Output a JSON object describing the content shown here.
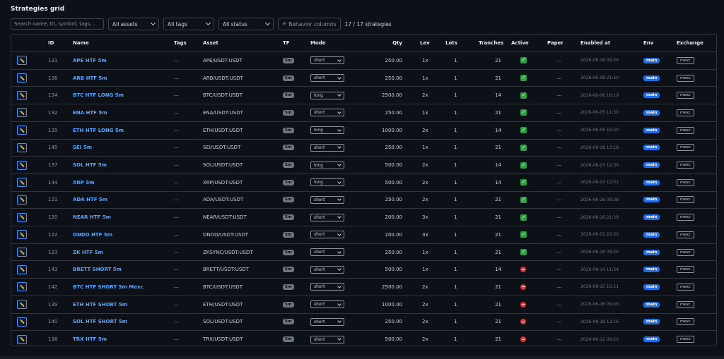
{
  "title": "Strategies grid",
  "toolbar": {
    "search_placeholder": "Search name, ID, symbol, tags…",
    "assets_filter": "All assets",
    "tags_filter": "All tags",
    "status_filter": "All status",
    "behavior_columns_label": "Behavior columns",
    "count_text": "17 / 17 strategies"
  },
  "columns": {
    "id": "ID",
    "name": "Name",
    "tags": "Tags",
    "asset": "Asset",
    "tf": "TF",
    "mode": "Mode",
    "qty": "Qty",
    "lev": "Lev",
    "lots": "Lots",
    "tranches": "Tranches",
    "active": "Active",
    "paper": "Paper",
    "enabled_at": "Enabled at",
    "env": "Env",
    "exchange": "Exchange"
  },
  "rows": [
    {
      "id": "131",
      "name": "APE HTF 5m",
      "tags": "—",
      "asset": "APE/USDT:USDT",
      "tf": "5m",
      "mode": "short",
      "qty": "250.00",
      "lev": "1x",
      "lots": "1",
      "tranches": "21",
      "active": true,
      "paper": "—",
      "enabled_at": "2026-08-16 09:26",
      "env": "main",
      "exchange": "mexc"
    },
    {
      "id": "136",
      "name": "ARB HTF 5m",
      "tags": "—",
      "asset": "ARB/USDT:USDT",
      "tf": "5m",
      "mode": "short",
      "qty": "250.00",
      "lev": "1x",
      "lots": "1",
      "tranches": "21",
      "active": true,
      "paper": "—",
      "enabled_at": "2026-06-08 21:50",
      "env": "main",
      "exchange": "mexc"
    },
    {
      "id": "134",
      "name": "BTC HTF LONG 5m",
      "tags": "—",
      "asset": "BTC/USDT:USDT",
      "tf": "5m",
      "mode": "long",
      "qty": "2500.00",
      "lev": "2x",
      "lots": "1",
      "tranches": "14",
      "active": true,
      "paper": "—",
      "enabled_at": "2026-06-06 16:19",
      "env": "main",
      "exchange": "mexc"
    },
    {
      "id": "132",
      "name": "ENA HTF 5m",
      "tags": "—",
      "asset": "ENA/USDT:USDT",
      "tf": "5m",
      "mode": "short",
      "qty": "250.00",
      "lev": "1x",
      "lots": "1",
      "tranches": "21",
      "active": true,
      "paper": "—",
      "enabled_at": "2026-06-05 11:30",
      "env": "main",
      "exchange": "mexc"
    },
    {
      "id": "135",
      "name": "ETH HTF LONG 5m",
      "tags": "—",
      "asset": "ETH/USDT:USDT",
      "tf": "5m",
      "mode": "long",
      "qty": "1000.00",
      "lev": "2x",
      "lots": "1",
      "tranches": "14",
      "active": true,
      "paper": "—",
      "enabled_at": "2026-06-06 16:20",
      "env": "main",
      "exchange": "mexc"
    },
    {
      "id": "145",
      "name": "SEI 5m",
      "tags": "—",
      "asset": "SEI/USDT:USDT",
      "tf": "5m",
      "mode": "short",
      "qty": "250.00",
      "lev": "1x",
      "lots": "1",
      "tranches": "21",
      "active": true,
      "paper": "—",
      "enabled_at": "2026-08-18 13:18",
      "env": "main",
      "exchange": "mexc"
    },
    {
      "id": "137",
      "name": "SOL HTF 5m",
      "tags": "—",
      "asset": "SOL/USDT:USDT",
      "tf": "5m",
      "mode": "long",
      "qty": "500.00",
      "lev": "2x",
      "lots": "1",
      "tranches": "14",
      "active": true,
      "paper": "—",
      "enabled_at": "2026-08-23 12:39",
      "env": "main",
      "exchange": "mexc"
    },
    {
      "id": "144",
      "name": "XRP 5m",
      "tags": "—",
      "asset": "XRP/USDT:USDT",
      "tf": "5m",
      "mode": "long",
      "qty": "500.00",
      "lev": "2x",
      "lots": "1",
      "tranches": "14",
      "active": true,
      "paper": "—",
      "enabled_at": "2026-08-23 12:51",
      "env": "main",
      "exchange": "mexc"
    },
    {
      "id": "121",
      "name": "ADA HTF 5m",
      "tags": "—",
      "asset": "ADA/USDT:USDT",
      "tf": "5m",
      "mode": "short",
      "qty": "250.00",
      "lev": "2x",
      "lots": "1",
      "tranches": "21",
      "active": true,
      "paper": "—",
      "enabled_at": "2026-06-16 09:28",
      "env": "main",
      "exchange": "mexc"
    },
    {
      "id": "120",
      "name": "NEAR HTF 5m",
      "tags": "—",
      "asset": "NEAR/USDT:USDT",
      "tf": "5m",
      "mode": "short",
      "qty": "200.00",
      "lev": "3x",
      "lots": "1",
      "tranches": "21",
      "active": true,
      "paper": "—",
      "enabled_at": "2026-06-16 21:59",
      "env": "main",
      "exchange": "mexc"
    },
    {
      "id": "122",
      "name": "ONDO HTF 5m",
      "tags": "—",
      "asset": "ONDO/USDT:USDT",
      "tf": "5m",
      "mode": "short",
      "qty": "200.00",
      "lev": "3x",
      "lots": "1",
      "tranches": "21",
      "active": true,
      "paper": "—",
      "enabled_at": "2026-06-01 22:20",
      "env": "main",
      "exchange": "mexc"
    },
    {
      "id": "123",
      "name": "ZK HTF 5m",
      "tags": "—",
      "asset": "ZKSYNC/USDT:USDT",
      "tf": "5m",
      "mode": "short",
      "qty": "250.00",
      "lev": "1x",
      "lots": "1",
      "tranches": "21",
      "active": true,
      "paper": "—",
      "enabled_at": "2026-06-16 09:25",
      "env": "main",
      "exchange": "mexc"
    },
    {
      "id": "143",
      "name": "BRETT SHORT 5m",
      "tags": "—",
      "asset": "BRETT/USDT:USDT",
      "tf": "5m",
      "mode": "short",
      "qty": "500.00",
      "lev": "1x",
      "lots": "1",
      "tranches": "14",
      "active": false,
      "paper": "—",
      "enabled_at": "2026-08-14 11:24",
      "env": "main",
      "exchange": "mexc"
    },
    {
      "id": "142",
      "name": "BTC HTF SHORT 5m Mexc",
      "tags": "—",
      "asset": "BTC/USDT:USDT",
      "tf": "5m",
      "mode": "short",
      "qty": "2500.00",
      "lev": "2x",
      "lots": "1",
      "tranches": "21",
      "active": false,
      "paper": "—",
      "enabled_at": "2026-08-15 15:11",
      "env": "main",
      "exchange": "mexc"
    },
    {
      "id": "139",
      "name": "ETH HTF SHORT 5m",
      "tags": "—",
      "asset": "ETH/USDT:USDT",
      "tf": "5m",
      "mode": "short",
      "qty": "1000.00",
      "lev": "2x",
      "lots": "1",
      "tranches": "21",
      "active": false,
      "paper": "—",
      "enabled_at": "2026-06-16 09:29",
      "env": "main",
      "exchange": "mexc"
    },
    {
      "id": "140",
      "name": "SOL HTF SHORT 5m",
      "tags": "—",
      "asset": "SOL/USDT:USDT",
      "tf": "5m",
      "mode": "short",
      "qty": "250.00",
      "lev": "2x",
      "lots": "1",
      "tranches": "21",
      "active": false,
      "paper": "—",
      "enabled_at": "2026-08-18 13:16",
      "env": "main",
      "exchange": "mexc"
    },
    {
      "id": "138",
      "name": "TRX HTF 5m",
      "tags": "—",
      "asset": "TRX/USDT:USDT",
      "tf": "5m",
      "mode": "short",
      "qty": "500.00",
      "lev": "2x",
      "lots": "1",
      "tranches": "21",
      "active": false,
      "paper": "—",
      "enabled_at": "2026-06-12 09:20",
      "env": "main",
      "exchange": "mexc"
    }
  ],
  "icons": {
    "edit": "pencil-icon",
    "active_true": "checkmark-icon",
    "active_false": "stop-icon",
    "dropdown": "chevron-down-icon"
  },
  "colors": {
    "link": "#58a6ff",
    "active": "#2ea043",
    "inactive": "#da3633",
    "env_badge": "#1f6feb"
  }
}
